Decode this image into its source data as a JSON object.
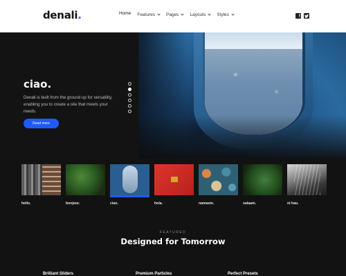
{
  "header": {
    "logo_text": "denali",
    "logo_dot": ".",
    "nav": [
      {
        "label": "Home",
        "has_dropdown": false
      },
      {
        "label": "Features",
        "has_dropdown": true
      },
      {
        "label": "Pages",
        "has_dropdown": true
      },
      {
        "label": "Layouts",
        "has_dropdown": true
      },
      {
        "label": "Styles",
        "has_dropdown": true
      }
    ],
    "social": [
      {
        "icon": "facebook-icon",
        "glyph": "f"
      },
      {
        "icon": "twitter-icon",
        "glyph": "t"
      }
    ]
  },
  "hero": {
    "title": "ciao.",
    "description": "Denali is built from the ground up for versatility, enabling you to create a site that meets your needs.",
    "button_label": "Read more",
    "slide_count": 6,
    "active_slide": 1
  },
  "thumbnails": [
    {
      "label": "hello.",
      "style": "building"
    },
    {
      "label": "bonjour.",
      "style": "plant"
    },
    {
      "label": "ciao.",
      "style": "window",
      "active": true
    },
    {
      "label": "hola.",
      "style": "red"
    },
    {
      "label": "namaste.",
      "style": "tiles"
    },
    {
      "label": "salaam.",
      "style": "fern"
    },
    {
      "label": "ni hau.",
      "style": "escalator"
    }
  ],
  "featured": {
    "eyebrow": "FEATURED",
    "title": "Designed for Tomorrow",
    "columns": [
      "Brilliant Sliders",
      "Premium Particles",
      "Perfect Presets"
    ]
  },
  "colors": {
    "accent": "#1e5bff",
    "background": "#121212",
    "header_bg": "#ffffff"
  }
}
